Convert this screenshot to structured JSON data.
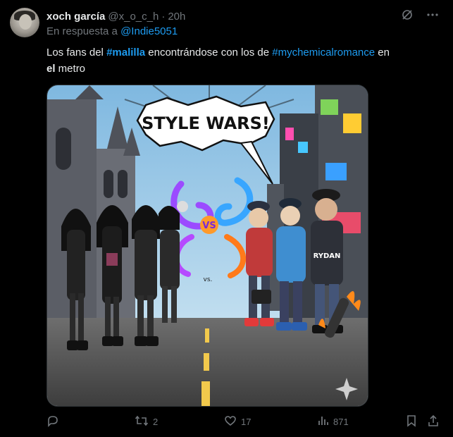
{
  "tweet": {
    "author_name": "xoch garcía",
    "author_handle": "@x_o_c_h",
    "separator": "·",
    "time": "20h",
    "reply_prefix": "En respuesta a",
    "reply_mention": "@Indie5051",
    "text_parts": {
      "p1": "Los fans del ",
      "tag1_hash": "#",
      "tag1_bold": "malilla",
      "p2": " encontrándose con los de ",
      "tag2": "#mychemicalromance",
      "p3": " en",
      "p4": "el",
      "p5": " metro"
    }
  },
  "media": {
    "speech_bubble": "STYLE WARS!",
    "vs_center": "VS",
    "vs_small": "vs.",
    "hoodie_text": "RYDAN"
  },
  "actions": {
    "reply_count": "",
    "retweet_count": "2",
    "like_count": "17",
    "views_count": "871"
  },
  "icons": [
    "mute-icon",
    "more-icon",
    "reply-icon",
    "retweet-icon",
    "like-icon",
    "views-icon",
    "bookmark-icon",
    "share-icon"
  ],
  "colors": {
    "link": "#1d9bf0",
    "muted": "#71767b",
    "text": "#e7e9ea",
    "background": "#000000"
  }
}
